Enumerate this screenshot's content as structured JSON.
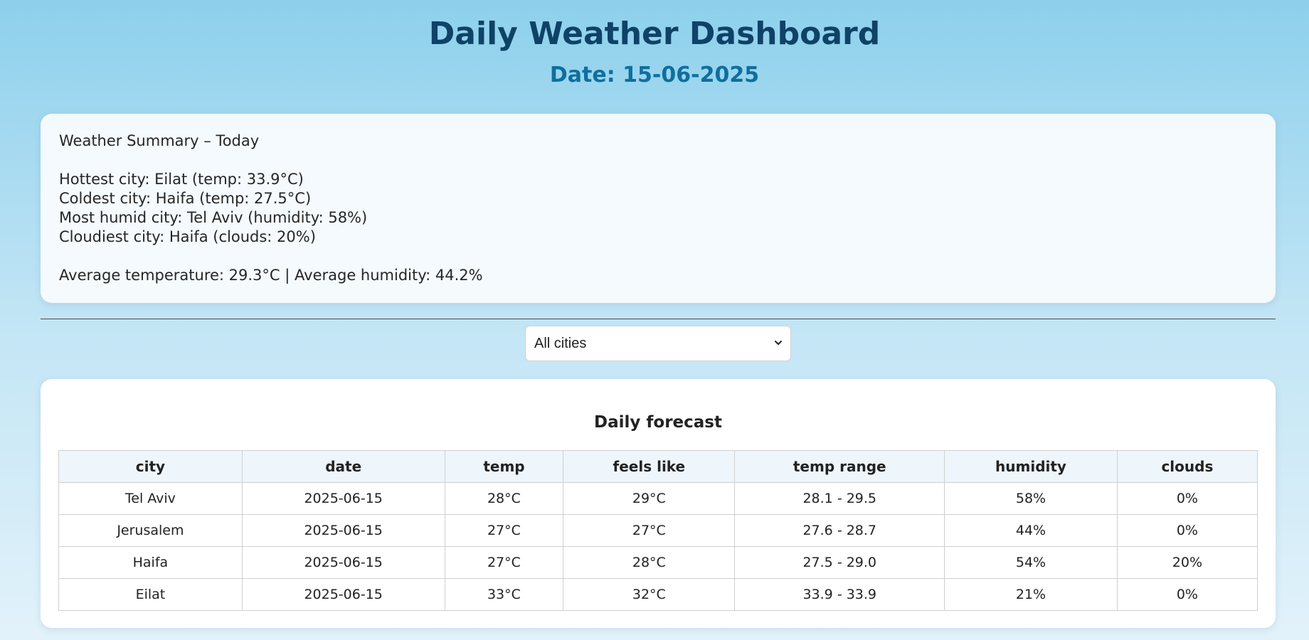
{
  "header": {
    "title": "Daily Weather Dashboard",
    "date": "Date: 15-06-2025"
  },
  "summary": {
    "heading": "Weather Summary – Today",
    "hottest": "Hottest city: Eilat (temp: 33.9°C)",
    "coldest": "Coldest city: Haifa (temp: 27.5°C)",
    "most_humid": "Most humid city: Tel Aviv (humidity: 58%)",
    "cloudiest": "Cloudiest city: Haifa (clouds: 20%)",
    "averages": "Average temperature: 29.3°C | Average humidity: 44.2%"
  },
  "filter": {
    "selected": "All cities"
  },
  "forecast": {
    "title": "Daily forecast",
    "columns": [
      "city",
      "date",
      "temp",
      "feels like",
      "temp range",
      "humidity",
      "clouds"
    ],
    "rows": [
      [
        "Tel Aviv",
        "2025-06-15",
        "28°C",
        "29°C",
        "28.1 - 29.5",
        "58%",
        "0%"
      ],
      [
        "Jerusalem",
        "2025-06-15",
        "27°C",
        "27°C",
        "27.6 - 28.7",
        "44%",
        "0%"
      ],
      [
        "Haifa",
        "2025-06-15",
        "27°C",
        "28°C",
        "27.5 - 29.0",
        "54%",
        "20%"
      ],
      [
        "Eilat",
        "2025-06-15",
        "33°C",
        "32°C",
        "33.9 - 33.9",
        "21%",
        "0%"
      ]
    ]
  },
  "colors": {
    "title": "#0e4266",
    "date": "#0e6f9e",
    "header_row_bg": "#eef6fc"
  }
}
